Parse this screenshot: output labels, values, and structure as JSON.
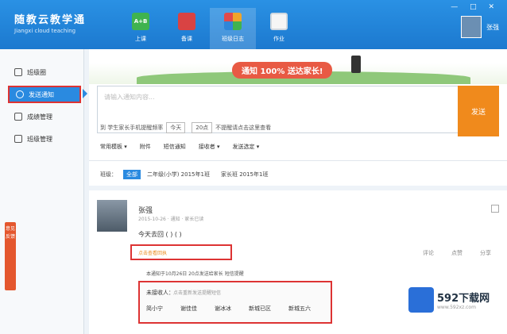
{
  "app": {
    "title_cn": "随教云教学通",
    "title_en": "Jiangxi cloud teaching",
    "window_controls": "— □ ✕"
  },
  "nav": {
    "items": [
      {
        "label": "上课",
        "icon_text": "A+B"
      },
      {
        "label": "备课"
      },
      {
        "label": "班级日志"
      },
      {
        "label": "作业"
      }
    ]
  },
  "user": {
    "name": "张强"
  },
  "sidebar": {
    "items": [
      {
        "label": "班级圈"
      },
      {
        "label": "发送通知"
      },
      {
        "label": "成绩管理"
      },
      {
        "label": "班级管理"
      }
    ],
    "feedback": "意见反馈"
  },
  "banner": {
    "message": "通知 100% 送达家长!"
  },
  "composer": {
    "placeholder": "请输入通知内容...",
    "send": "发送",
    "option_text": "到 学生家长手机提醒频率",
    "sel1": "今天",
    "sel2": "20点",
    "option_tail": "不提醒请点击这里查看"
  },
  "toolbar": {
    "items": [
      "常用模板 ▾",
      "附件",
      "短信通知",
      "接收者 ▾",
      "发送选定 ▾"
    ]
  },
  "classes": {
    "label": "班级：",
    "badge": "全部",
    "items": [
      "二年级(小学) 2015年1班",
      "家长班 2015年1班"
    ]
  },
  "post": {
    "name": "张强",
    "meta": "2015-10-26  · 通知 · 家长已读",
    "text": "今天去回 ( ) ( )",
    "received_link": "点击查看回执",
    "actions": [
      "评论",
      "点赞",
      "分享"
    ],
    "notice": "本通知于10月26日 20点发送给家长 短信提醒",
    "unreceived_label": "未接收人：",
    "unreceived_link": "点击重新发送提醒短信",
    "names": [
      "简小宁",
      "谢佳佳",
      "谢冰冰",
      "新城已区",
      "新城五六"
    ]
  },
  "watermark": {
    "text": "592下载网",
    "sub": "www.592xz.com"
  }
}
